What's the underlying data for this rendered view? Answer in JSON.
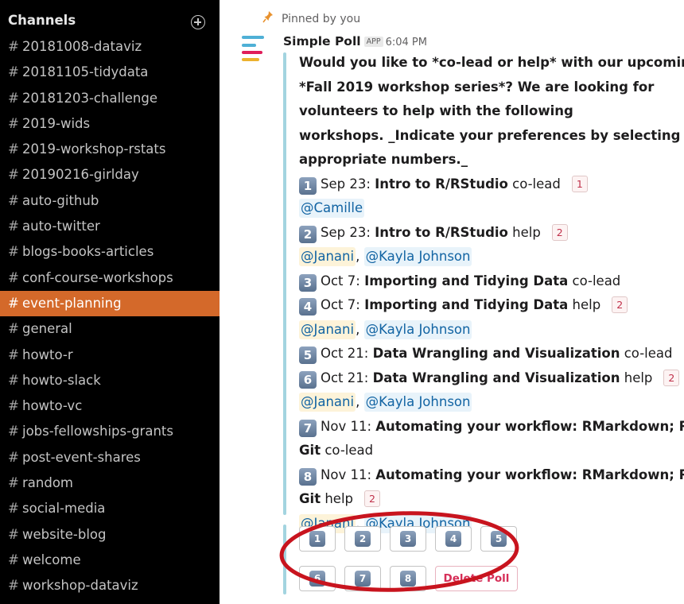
{
  "sidebar": {
    "title": "Channels",
    "add_icon": "circle-plus-icon",
    "hash": "#",
    "channels": [
      {
        "name": "20181008-dataviz",
        "active": false
      },
      {
        "name": "20181105-tidydata",
        "active": false
      },
      {
        "name": "20181203-challenge",
        "active": false
      },
      {
        "name": "2019-wids",
        "active": false
      },
      {
        "name": "2019-workshop-rstats",
        "active": false
      },
      {
        "name": "20190216-girlday",
        "active": false
      },
      {
        "name": "auto-github",
        "active": false
      },
      {
        "name": "auto-twitter",
        "active": false
      },
      {
        "name": "blogs-books-articles",
        "active": false
      },
      {
        "name": "conf-course-workshops",
        "active": false
      },
      {
        "name": "event-planning",
        "active": true
      },
      {
        "name": "general",
        "active": false
      },
      {
        "name": "howto-r",
        "active": false
      },
      {
        "name": "howto-slack",
        "active": false
      },
      {
        "name": "howto-vc",
        "active": false
      },
      {
        "name": "jobs-fellowships-grants",
        "active": false
      },
      {
        "name": "post-event-shares",
        "active": false
      },
      {
        "name": "random",
        "active": false
      },
      {
        "name": "social-media",
        "active": false
      },
      {
        "name": "website-blog",
        "active": false
      },
      {
        "name": "welcome",
        "active": false
      },
      {
        "name": "workshop-dataviz",
        "active": false
      }
    ]
  },
  "message": {
    "pinned_text": "Pinned by you",
    "sender": "Simple Poll",
    "badge": "APP",
    "time": "6:04 PM",
    "intro_lines": [
      "Would you like to *co-lead or help* with our upcoming",
      "*Fall 2019 workshop series*? We are looking for",
      "volunteers to help with the following",
      "workshops. _Indicate your preferences by selecting the",
      "appropriate numbers._"
    ],
    "options": {
      "o1": {
        "num": "1",
        "date": "Sep 23:",
        "title": "Intro to R/RStudio",
        "role": "co-lead",
        "count": "1",
        "m1": "@Camille"
      },
      "o2": {
        "num": "2",
        "date": "Sep 23:",
        "title": "Intro to R/RStudio",
        "role": "help",
        "count": "2",
        "m1": "@Janani",
        "m2": "@Kayla Johnson"
      },
      "o3": {
        "num": "3",
        "date": "Oct 7:",
        "title": "Importing and Tidying Data",
        "role": "co-lead"
      },
      "o4": {
        "num": "4",
        "date": "Oct 7:",
        "title": "Importing and Tidying Data",
        "role": "help",
        "count": "2",
        "m1": "@Janani",
        "m2": "@Kayla Johnson"
      },
      "o5": {
        "num": "5",
        "date": "Oct 21:",
        "title": "Data Wrangling and Visualization",
        "role": "co-lead"
      },
      "o6": {
        "num": "6",
        "date": "Oct 21:",
        "title": "Data Wrangling and Visualization",
        "role": "help",
        "count": "2",
        "m1": "@Janani",
        "m2": "@Kayla Johnson"
      },
      "o7": {
        "num": "7",
        "date": "Nov 11:",
        "title_a": "Automating your workflow: RMarkdown; R &",
        "title_b": "Git",
        "role": "co-lead"
      },
      "o8": {
        "num": "8",
        "date": "Nov 11:",
        "title_a": "Automating your workflow: RMarkdown; R &",
        "title_b": "Git",
        "role": "help",
        "count": "2",
        "m1": "@Janani",
        "m2": "@Kayla Johnson"
      }
    },
    "comma": ",",
    "buttons": {
      "row1": [
        "1",
        "2",
        "3",
        "4",
        "5"
      ],
      "row2": [
        "6",
        "7",
        "8"
      ],
      "delete_label": "Delete Poll"
    }
  },
  "colors": {
    "sidebar_bg": "#000000",
    "active_channel": "#d4692a",
    "attachment_bar": "#a3d4e0",
    "mention_text": "#1264a3",
    "annotation": "#c8141e",
    "delete_text": "#d62f58"
  }
}
